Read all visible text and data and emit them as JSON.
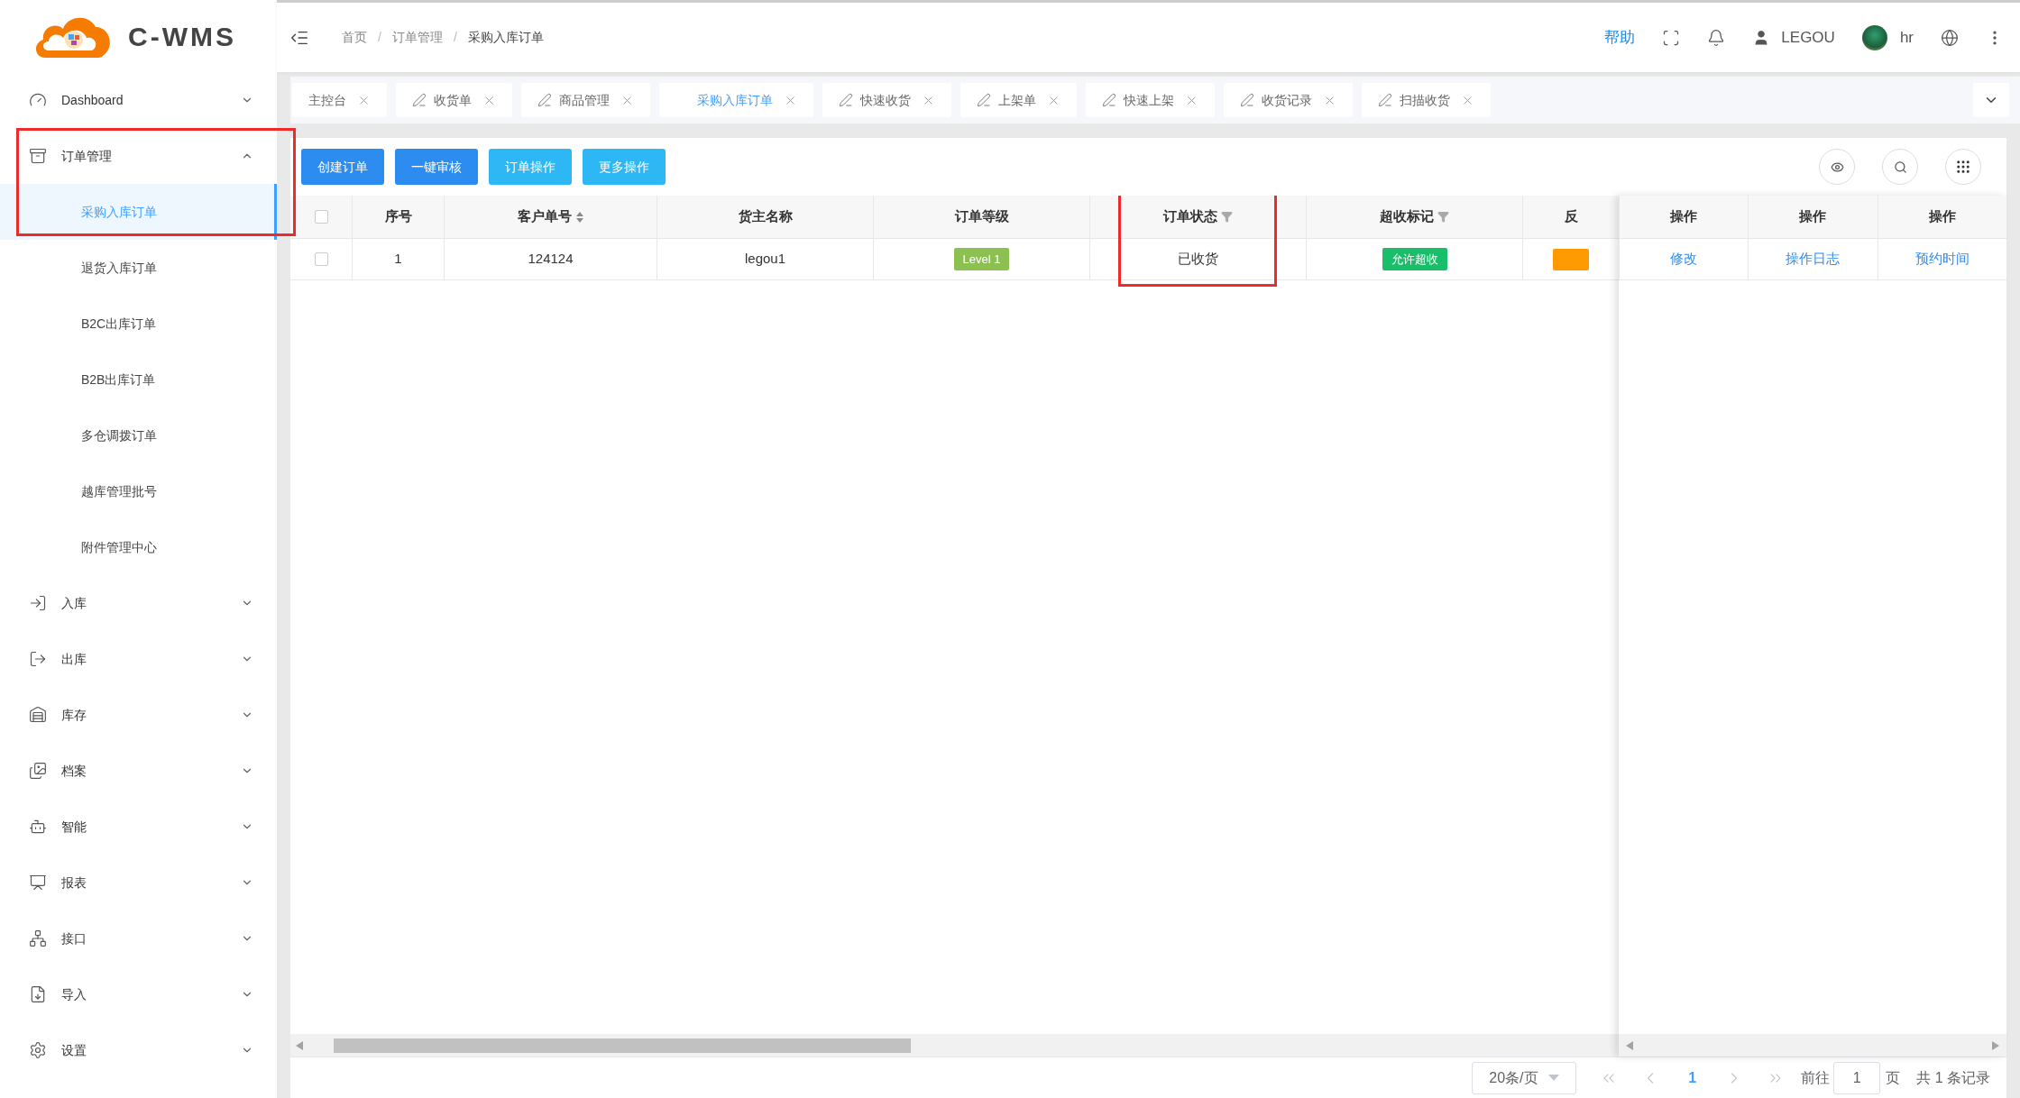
{
  "logo": {
    "text": "C-WMS"
  },
  "sidebar": {
    "items": [
      {
        "label": "Dashboard",
        "expanded": false
      },
      {
        "label": "订单管理",
        "expanded": true,
        "highlighted": true,
        "children": [
          {
            "label": "采购入库订单",
            "selected": true
          },
          {
            "label": "退货入库订单",
            "selected": false
          },
          {
            "label": "B2C出库订单",
            "selected": false
          },
          {
            "label": "B2B出库订单",
            "selected": false
          },
          {
            "label": "多仓调拨订单",
            "selected": false
          },
          {
            "label": "越库管理批号",
            "selected": false
          },
          {
            "label": "附件管理中心",
            "selected": false
          }
        ]
      },
      {
        "label": "入库",
        "expanded": false
      },
      {
        "label": "出库",
        "expanded": false
      },
      {
        "label": "库存",
        "expanded": false
      },
      {
        "label": "档案",
        "expanded": false
      },
      {
        "label": "智能",
        "expanded": false
      },
      {
        "label": "报表",
        "expanded": false
      },
      {
        "label": "接口",
        "expanded": false
      },
      {
        "label": "导入",
        "expanded": false
      },
      {
        "label": "设置",
        "expanded": false
      }
    ]
  },
  "header": {
    "separator": "/",
    "breadcrumb": [
      "首页",
      "订单管理",
      "采购入库订单"
    ],
    "help": "帮助",
    "user": "LEGOU",
    "account": "hr"
  },
  "tabs": [
    {
      "label": "主控台",
      "kind": "plain",
      "selected": false
    },
    {
      "label": "收货单",
      "kind": "pencil",
      "selected": false
    },
    {
      "label": "商品管理",
      "kind": "pencil",
      "selected": false
    },
    {
      "label": "采购入库订单",
      "kind": "plain",
      "selected": true
    },
    {
      "label": "快速收货",
      "kind": "pencil",
      "selected": false
    },
    {
      "label": "上架单",
      "kind": "pencil",
      "selected": false
    },
    {
      "label": "快速上架",
      "kind": "pencil",
      "selected": false
    },
    {
      "label": "收货记录",
      "kind": "pencil",
      "selected": false
    },
    {
      "label": "扫描收货",
      "kind": "pencil",
      "selected": false
    }
  ],
  "toolbar": {
    "buttons": [
      {
        "label": "创建订单",
        "kind": "primary"
      },
      {
        "label": "一键审核",
        "kind": "primary"
      },
      {
        "label": "订单操作",
        "kind": "info"
      },
      {
        "label": "更多操作",
        "kind": "info"
      }
    ]
  },
  "table": {
    "select_all": {
      "checked": false
    },
    "columns": [
      {
        "label": "序号",
        "kind": "plain",
        "highlighted": false
      },
      {
        "label": "客户单号",
        "kind": "sort",
        "highlighted": false
      },
      {
        "label": "货主名称",
        "kind": "plain",
        "highlighted": false
      },
      {
        "label": "订单等级",
        "kind": "plain",
        "highlighted": false
      },
      {
        "label": "订单状态",
        "kind": "filter",
        "highlighted": true
      },
      {
        "label": "超收标记",
        "kind": "filter",
        "highlighted": false
      },
      {
        "label": "反",
        "kind": "plain",
        "highlighted": false
      }
    ],
    "fixed_columns": [
      "操作",
      "操作",
      "操作"
    ],
    "rows": [
      {
        "checked": false,
        "cells": [
          {
            "kind": "text",
            "text": "1"
          },
          {
            "kind": "text",
            "text": "124124"
          },
          {
            "kind": "text",
            "text": "legou1"
          },
          {
            "kind": "tag",
            "text": "Level 1",
            "color": "#8cc152"
          },
          {
            "kind": "text",
            "text": "已收货"
          },
          {
            "kind": "tag",
            "text": "允许超收",
            "color": "#19be6b"
          },
          {
            "kind": "tag",
            "color": "#ff9900"
          }
        ],
        "actions": [
          "修改",
          "操作日志",
          "预约时间"
        ]
      }
    ]
  },
  "pagination": {
    "page_size": "20条/页",
    "pages": [
      {
        "label": "1",
        "selected": true
      }
    ],
    "goto_label": "前往",
    "goto_value": "1",
    "page_unit": "页",
    "total": "共 1 条记录"
  }
}
